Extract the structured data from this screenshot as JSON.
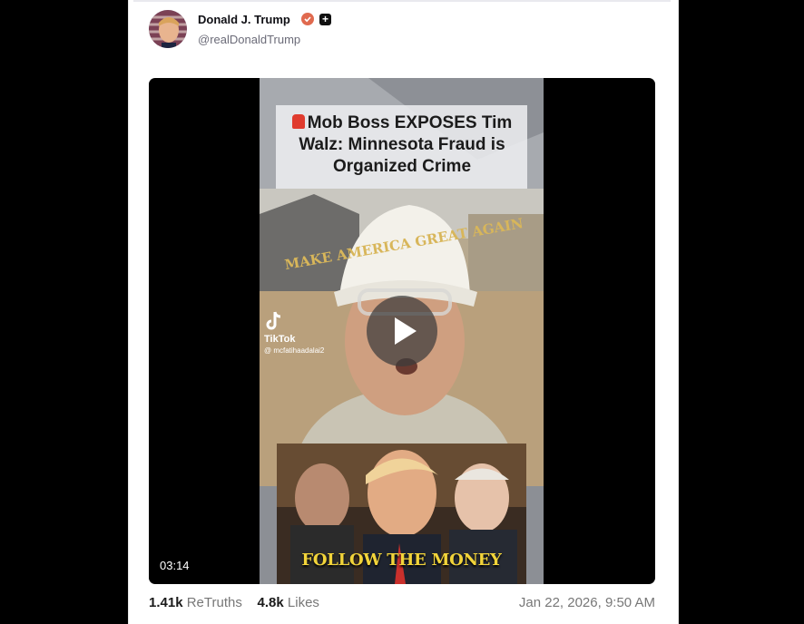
{
  "post": {
    "author_name": "Donald J. Trump",
    "handle": "@realDonaldTrump",
    "verified_icon": "verified-badge-icon",
    "plus_icon": "plus-icon"
  },
  "video": {
    "caption": "Mob Boss EXPOSES Tim Walz: Minnesota Fraud is Organized Crime",
    "hat_text": "MAKE AMERICA GREAT AGAIN",
    "tiktok_label": "TikTok",
    "tiktok_user": "@ mcfatihaadalai2",
    "overlay_text": "FOLLOW THE MONEY",
    "duration": "03:14"
  },
  "stats": {
    "retruths_count": "1.41k",
    "retruths_label": "ReTruths",
    "likes_count": "4.8k",
    "likes_label": "Likes",
    "timestamp": "Jan 22, 2026, 9:50 AM"
  },
  "colors": {
    "verified": "#e06a4f",
    "overlay_yellow": "#f2d43a"
  }
}
